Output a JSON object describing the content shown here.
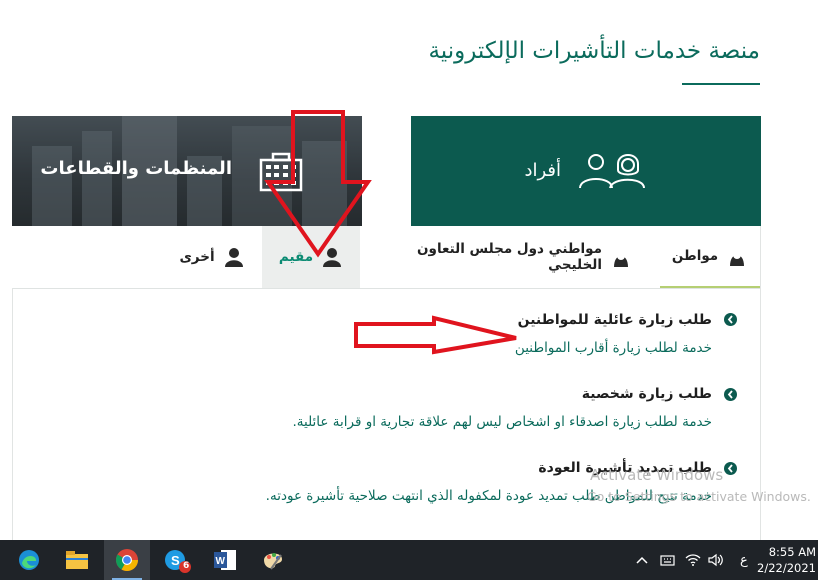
{
  "page": {
    "title": "منصة خدمات التأشيرات الإلكترونية"
  },
  "categories": {
    "individuals": {
      "label": "أفراد",
      "icon": "users-icon"
    },
    "organizations": {
      "label": "المنظمات والقطاعات",
      "icon": "building-icon"
    }
  },
  "tabs": [
    {
      "label": "مواطن",
      "icon": "person-headscarf-icon",
      "selected": false
    },
    {
      "label": "مواطني دول مجلس التعاون الخليجي",
      "icon": "person-headscarf-icon",
      "selected": false
    },
    {
      "label": "مقيم",
      "icon": "person-icon",
      "selected": true
    },
    {
      "label": "أخرى",
      "icon": "person-icon",
      "selected": false
    }
  ],
  "services": [
    {
      "title": "طلب زيارة عائلية للمواطنين",
      "description": "خدمة لطلب زيارة أقارب المواطنين"
    },
    {
      "title": "طلب زيارة شخصية",
      "description": "خدمة لطلب زيارة اصدقاء او اشخاص ليس لهم علاقة تجارية او قرابة عائلية."
    },
    {
      "title": "طلب تمديد تأشيرة العودة",
      "description": "خدمة تتيح للمواطن طلب تمديد عودة لمكفوله الذي انتهت صلاحية تأشيرة عودته."
    }
  ],
  "watermark": {
    "line1": "Activate Windows",
    "line2": "Go to Settings to activate Windows."
  },
  "taskbar": {
    "apps": [
      "edge-icon",
      "file-explorer-icon",
      "chrome-icon",
      "skype-icon",
      "word-icon",
      "paint-icon"
    ],
    "skype_badge": "6",
    "language": "ع",
    "time": "8:55 AM",
    "date": "2/22/2021"
  },
  "colors": {
    "brand_green": "#0c5a4f",
    "accent_text": "#0b6b5c",
    "annotation_red": "#e0141e"
  }
}
